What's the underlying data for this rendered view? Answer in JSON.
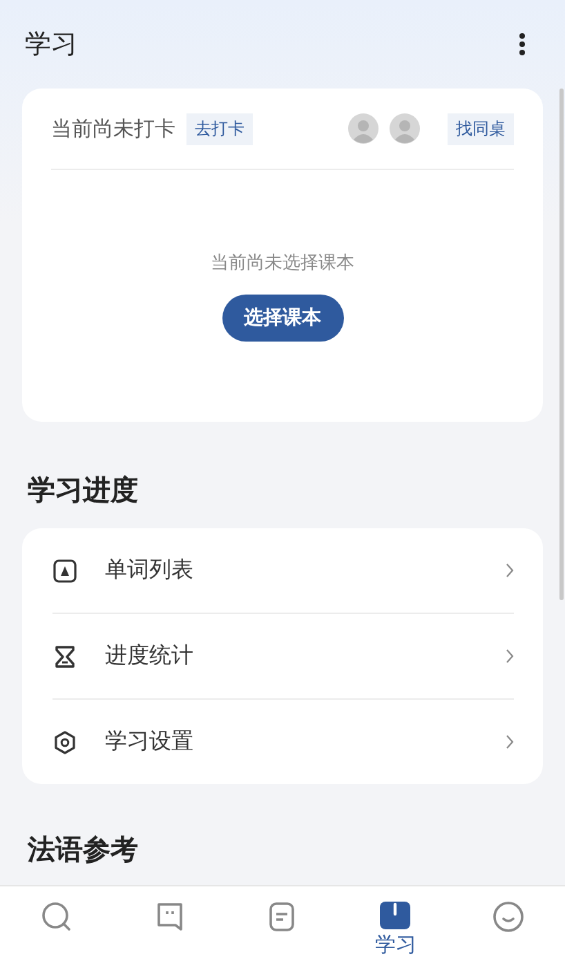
{
  "header": {
    "title": "学习"
  },
  "checkin": {
    "status": "当前尚未打卡",
    "action": "去打卡",
    "partner_action": "找同桌",
    "avatars": [
      {
        "kind": "default"
      },
      {
        "kind": "default"
      }
    ],
    "empty_text": "当前尚未选择课本",
    "select_button": "选择课本"
  },
  "progress": {
    "title": "学习进度",
    "items": [
      {
        "kind": "word-list",
        "label": "单词列表"
      },
      {
        "kind": "stats",
        "label": "进度统计"
      },
      {
        "kind": "settings",
        "label": "学习设置"
      }
    ]
  },
  "reference": {
    "title": "法语参考"
  },
  "nav": [
    {
      "kind": "search",
      "selected": false
    },
    {
      "kind": "chat",
      "selected": false
    },
    {
      "kind": "notes",
      "selected": false
    },
    {
      "kind": "study",
      "selected": true,
      "label": "学习"
    },
    {
      "kind": "profile",
      "selected": false
    }
  ]
}
